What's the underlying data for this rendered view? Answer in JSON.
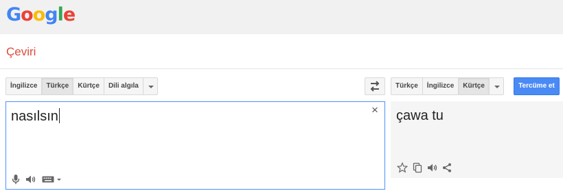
{
  "header": {
    "logo_letters": [
      "G",
      "o",
      "o",
      "g",
      "l",
      "e"
    ]
  },
  "page": {
    "title": "Çeviri"
  },
  "source_langs": {
    "items": [
      "İngilizce",
      "Türkçe",
      "Kürtçe",
      "Dili algıla"
    ],
    "selected": "Türkçe"
  },
  "target_langs": {
    "items": [
      "Türkçe",
      "İngilizce",
      "Kürtçe"
    ],
    "selected": "Kürtçe"
  },
  "translate_button": {
    "label": "Tercüme et"
  },
  "source": {
    "text": "nasılsın",
    "clear_glyph": "×"
  },
  "target": {
    "text": "çawa tu"
  },
  "icons": {
    "swap": "swap-arrows-icon",
    "source_tools": [
      "microphone-icon",
      "speaker-icon",
      "keyboard-icon"
    ],
    "target_tools": [
      "star-icon",
      "copy-icon",
      "speaker-icon",
      "share-icon"
    ]
  },
  "colors": {
    "header_bg": "#f1f1f1",
    "title": "#dd4b39",
    "accent_blue": "#4a8af4",
    "focus_border": "#4d90fe",
    "target_bg": "#f5f5f5"
  }
}
